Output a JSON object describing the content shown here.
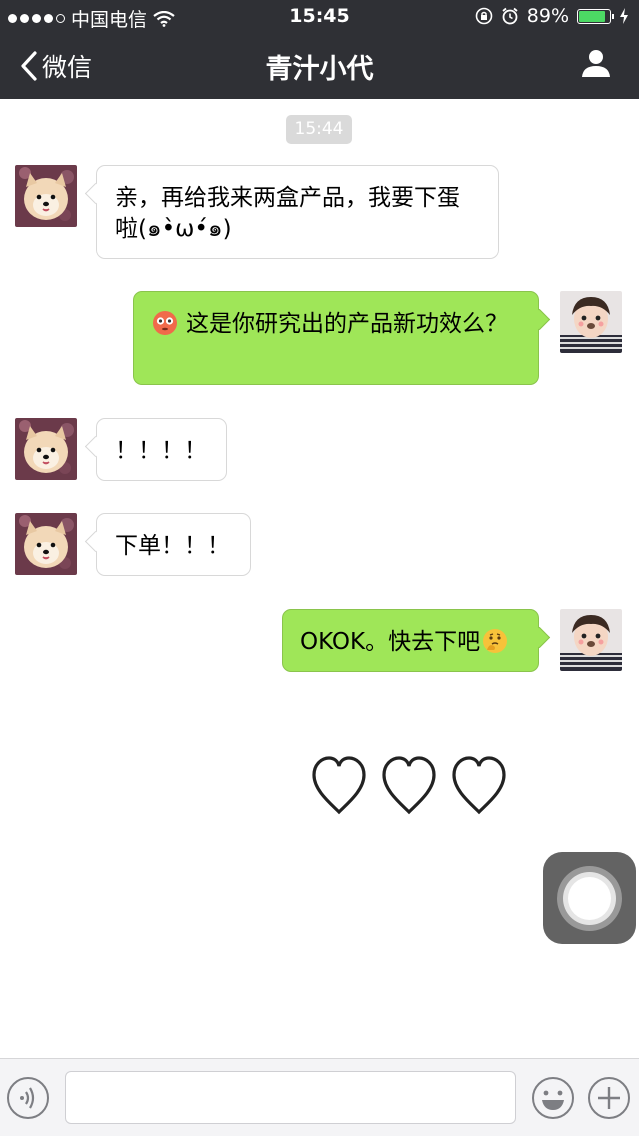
{
  "status_bar": {
    "carrier": "中国电信",
    "time": "15:45",
    "battery": "89%",
    "battery_level": 0.89,
    "signal_bars": 4,
    "signal_total": 5,
    "battery_color": "#4cd964"
  },
  "nav": {
    "back_label": "微信",
    "title": "青汁小代",
    "back_icon": "chevron-left-icon",
    "profile_icon": "person-icon"
  },
  "chat": {
    "timestamp": "15:44",
    "messages": [
      {
        "side": "incoming",
        "text": "亲，再给我来两盒产品，我要下蛋啦(๑•̀ω•́๑)"
      },
      {
        "side": "outgoing",
        "emoji": "flushed-face-emoji",
        "text": "这是你研究出的产品新功效么？"
      },
      {
        "side": "incoming",
        "text": "！！！！"
      },
      {
        "side": "incoming",
        "text": "下单！！！"
      },
      {
        "side": "outgoing",
        "text": "OKOK。快去下吧",
        "emoji_after": "thinking-face-emoji"
      }
    ],
    "hearts": [
      "heart-outline-icon",
      "heart-outline-icon",
      "heart-outline-icon"
    ]
  },
  "input_bar": {
    "value": "",
    "placeholder": "",
    "voice_icon": "voice-icon",
    "emoji_icon": "smiley-icon",
    "plus_icon": "plus-icon"
  },
  "colors": {
    "header_bg": "#2f3035",
    "outgoing_bubble": "#9fe658",
    "incoming_bubble": "#ffffff",
    "background": "#ffffff"
  }
}
